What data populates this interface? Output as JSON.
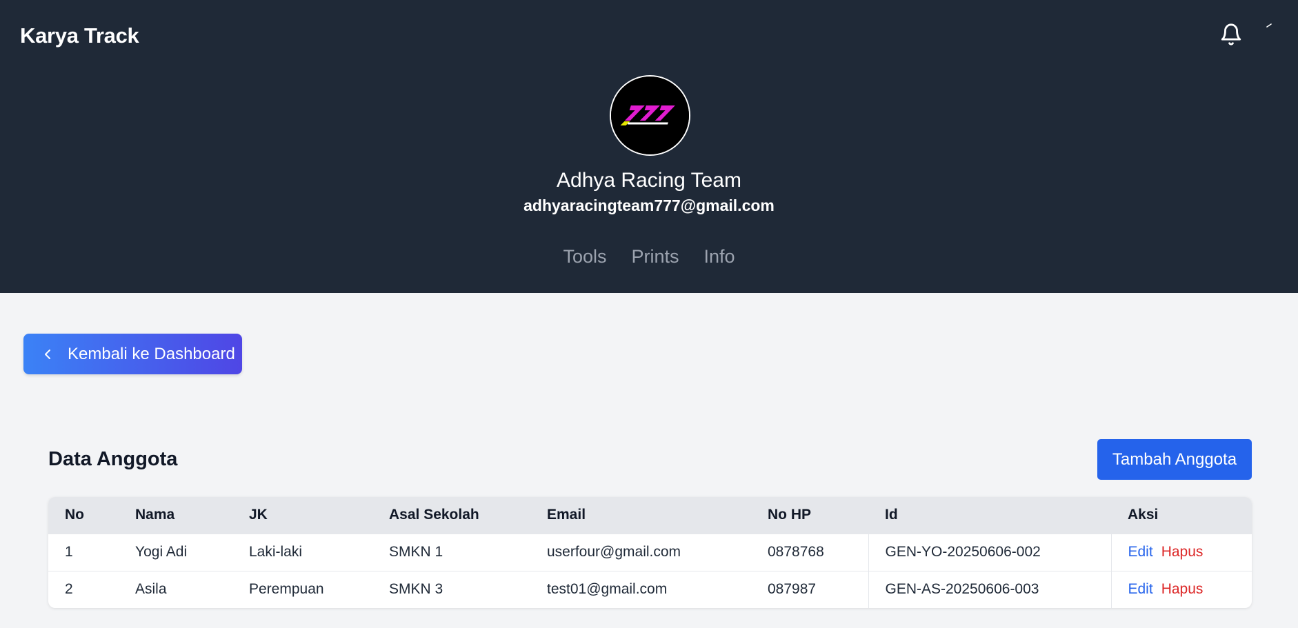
{
  "app": {
    "title": "Karya Track"
  },
  "header": {
    "team_name": "Adhya Racing Team",
    "team_email": "adhyaracingteam777@gmail.com",
    "nav": [
      {
        "label": "Tools"
      },
      {
        "label": "Prints"
      },
      {
        "label": "Info"
      }
    ],
    "icons": {
      "notification": "bell-icon",
      "avatar_logo": "777 racing logo"
    },
    "colors": {
      "background": "#1f2937",
      "logo_accent": "#e11cd0"
    }
  },
  "back_button": {
    "label": "Kembali ke Dashboard",
    "icon": "chevron-left-icon"
  },
  "members": {
    "title": "Data Anggota",
    "add_button": "Tambah Anggota",
    "columns": [
      "No",
      "Nama",
      "JK",
      "Asal Sekolah",
      "Email",
      "No HP",
      "Id",
      "Aksi"
    ],
    "rows": [
      {
        "no": "1",
        "nama": "Yogi Adi",
        "jk": "Laki-laki",
        "sekolah": "SMKN 1",
        "email": "userfour@gmail.com",
        "hp": "0878768",
        "id": "GEN-YO-20250606-002",
        "edit": "Edit",
        "hapus": "Hapus"
      },
      {
        "no": "2",
        "nama": "Asila",
        "jk": "Perempuan",
        "sekolah": "SMKN 3",
        "email": "test01@gmail.com",
        "hp": "087987",
        "id": "GEN-AS-20250606-003",
        "edit": "Edit",
        "hapus": "Hapus"
      }
    ],
    "colors": {
      "primary": "#2563eb",
      "danger": "#dc2626"
    }
  }
}
